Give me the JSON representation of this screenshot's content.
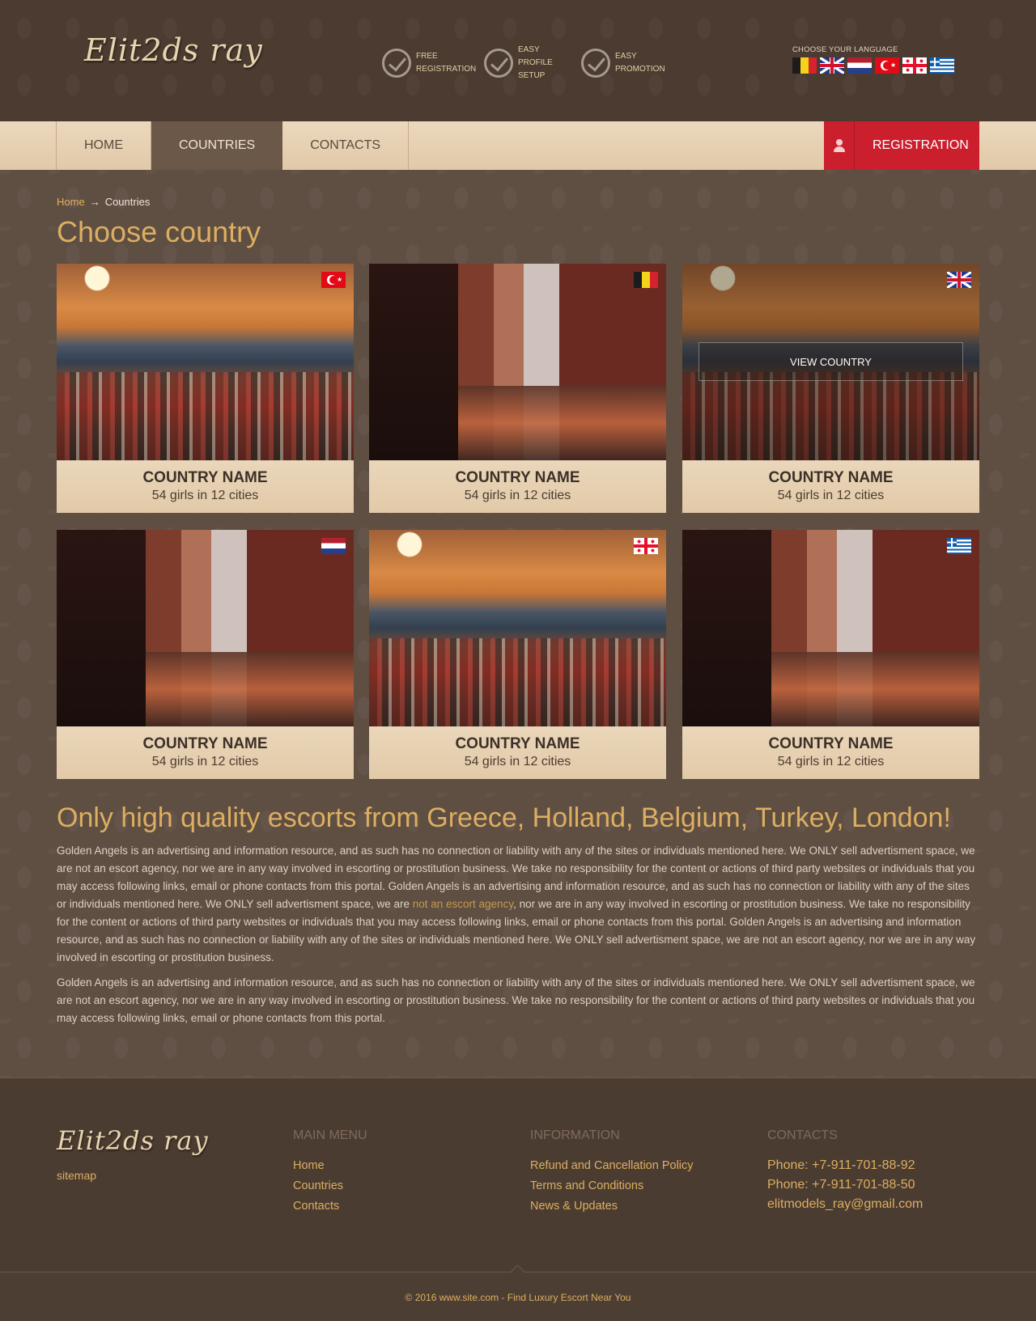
{
  "header": {
    "logo": "Elit2ds ray",
    "features": [
      {
        "line1": "FREE",
        "line2": "REGISTRATION"
      },
      {
        "line1": "EASY",
        "line2": "PROFILE SETUP"
      },
      {
        "line1": "EASY",
        "line2": "PROMOTION"
      }
    ],
    "language_label": "CHOOSE YOUR LANGUAGE",
    "languages": [
      "belgium-flag-icon",
      "uk-flag-icon",
      "netherlands-flag-icon",
      "turkey-flag-icon",
      "georgia-flag-icon",
      "greece-flag-icon"
    ]
  },
  "nav": {
    "items": [
      {
        "label": "HOME",
        "active": false
      },
      {
        "label": "COUNTRIES",
        "active": true
      },
      {
        "label": "CONTACTS",
        "active": false
      }
    ],
    "registration_label": "REGISTRATION"
  },
  "main": {
    "breadcrumb": {
      "home": "Home",
      "separator": "→",
      "current": "Countries"
    },
    "title": "Choose country",
    "cards": [
      {
        "name": "COUNTRY NAME",
        "count": "54 girls in 12 cities",
        "flag": "turkey-flag-icon"
      },
      {
        "name": "COUNTRY NAME",
        "count": "54 girls in 12 cities",
        "flag": "belgium-flag-icon"
      },
      {
        "name": "COUNTRY NAME",
        "count": "54 girls in 12 cities",
        "flag": "uk-flag-icon",
        "hover_label": "VIEW COUNTRY"
      },
      {
        "name": "COUNTRY NAME",
        "count": "54 girls in 12 cities",
        "flag": "netherlands-flag-icon"
      },
      {
        "name": "COUNTRY NAME",
        "count": "54 girls in 12 cities",
        "flag": "georgia-flag-icon"
      },
      {
        "name": "COUNTRY NAME",
        "count": "54 girls in 12 cities",
        "flag": "greece-flag-icon"
      }
    ],
    "seo_title": "Only high quality escorts from Greece, Holland, Belgium, Turkey, London!",
    "seo_p1_a": "Golden Angels is an advertising and information resource, and as such has no connection or liability with any of the sites or individuals mentioned here. We ONLY sell advertisment space, we are not an escort agency, nor we are in any way involved in escorting or prostitution business. We take no responsibility for the content or actions of third party websites or individuals that you may access following links, email or phone contacts from this portal. Golden Angels is an advertising and information resource, and as such has no connection or liability with any of the sites or individuals mentioned here. We ONLY sell advertisment space, we are ",
    "seo_p1_link": "not an escort agency",
    "seo_p1_b": ", nor we are in any way involved in escorting or prostitution business. We take no responsibility for the content or actions of third party websites or individuals that you may access following links, email or phone contacts from this portal. Golden Angels is an advertising and information resource, and as such has no connection or liability with any of the sites or individuals mentioned here. We ONLY sell advertisment space, we are not an escort agency, nor we are in any way involved in escorting or prostitution business.",
    "seo_p2": "Golden Angels is an advertising and information resource, and as such has no connection or liability with any of the sites or individuals mentioned here. We ONLY sell advertisment space, we are not an escort agency, nor we are in any way involved in escorting or prostitution business. We take no responsibility for the content or actions of third party websites or individuals that you may access following links, email or phone contacts from this portal."
  },
  "footer": {
    "logo": "Elit2ds ray",
    "sitemap": "sitemap",
    "main_menu": {
      "title": "MAIN MENU",
      "links": [
        "Home",
        "Countries",
        "Contacts"
      ]
    },
    "information": {
      "title": "INFORMATION",
      "links": [
        "Refund and Cancellation Policy",
        "Terms and Conditions",
        "News & Updates"
      ]
    },
    "contacts": {
      "title": "CONTACTS",
      "links": [
        "Phone: +7-911-701-88-92",
        "Phone: +7-911-701-88-50",
        "elitmodels_ray@gmail.com"
      ]
    },
    "copyright": "© 2016 www.site.com - Find Luxury Escort Near You"
  }
}
